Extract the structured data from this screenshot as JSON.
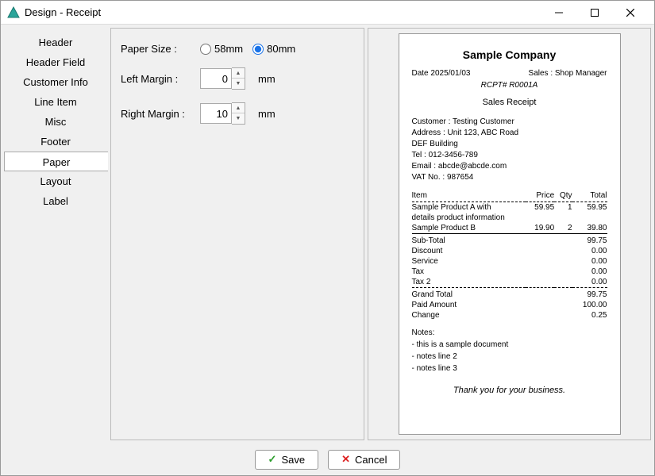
{
  "window": {
    "title": "Design - Receipt"
  },
  "sidebar": {
    "items": [
      {
        "label": "Header"
      },
      {
        "label": "Header Field"
      },
      {
        "label": "Customer Info"
      },
      {
        "label": "Line Item"
      },
      {
        "label": "Misc"
      },
      {
        "label": "Footer"
      },
      {
        "label": "Paper"
      },
      {
        "label": "Layout"
      },
      {
        "label": "Label"
      }
    ],
    "selected": "Paper"
  },
  "form": {
    "paperSizeLabel": "Paper Size :",
    "paperOption1": "58mm",
    "paperOption2": "80mm",
    "leftMarginLabel": "Left Margin :",
    "leftMarginValue": "0",
    "rightMarginLabel": "Right Margin :",
    "rightMarginValue": "10",
    "unit": "mm"
  },
  "preview": {
    "company": "Sample Company",
    "dateLabel": "Date",
    "date": "2025/01/03",
    "salesLabel": "Sales :",
    "sales": "Shop Manager",
    "rcpt": "RCPT# R0001A",
    "docTitle": "Sales Receipt",
    "info": {
      "customer": "Customer : Testing Customer",
      "address1": "Address : Unit 123, ABC Road",
      "address2": "DEF Building",
      "tel": "Tel : 012-3456-789",
      "email": "Email : abcde@abcde.com",
      "vat": "VAT No. : 987654"
    },
    "cols": {
      "item": "Item",
      "price": "Price",
      "qty": "Qty",
      "total": "Total"
    },
    "items": [
      {
        "name": "Sample Product A with",
        "name2": "details product information",
        "price": "59.95",
        "qty": "1",
        "total": "59.95"
      },
      {
        "name": "Sample Product B",
        "price": "19.90",
        "qty": "2",
        "total": "39.80"
      }
    ],
    "summary": [
      {
        "label": "Sub-Total",
        "value": "99.75"
      },
      {
        "label": "Discount",
        "value": "0.00"
      },
      {
        "label": "Service",
        "value": "0.00"
      },
      {
        "label": "Tax",
        "value": "0.00"
      },
      {
        "label": "Tax 2",
        "value": "0.00"
      },
      {
        "label": "Grand Total",
        "value": "99.75"
      },
      {
        "label": "Paid Amount",
        "value": "100.00"
      },
      {
        "label": "Change",
        "value": "0.25"
      }
    ],
    "notesTitle": "Notes:",
    "notes": [
      "- this is a sample document",
      "- notes line 2",
      "- notes line 3"
    ],
    "thanks": "Thank you for your business."
  },
  "footer": {
    "saveLabel": "Save",
    "cancelLabel": "Cancel"
  }
}
